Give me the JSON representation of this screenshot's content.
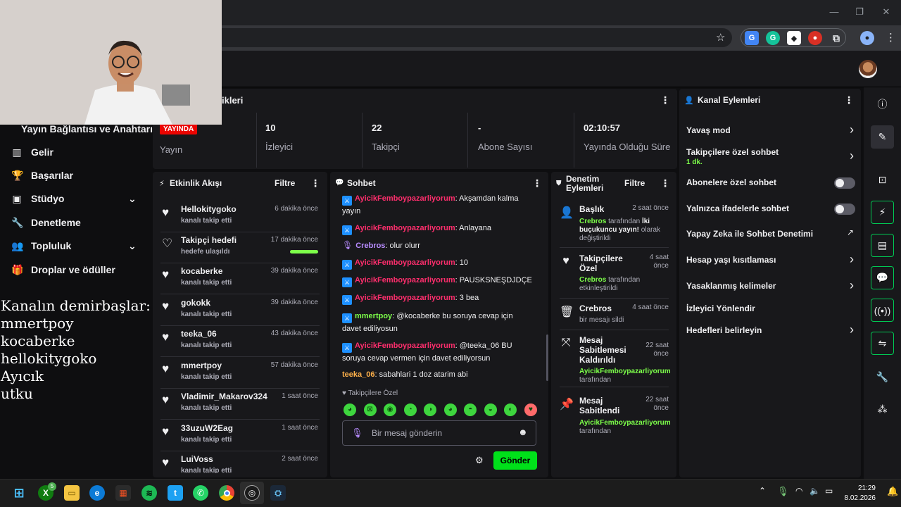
{
  "sidebar": {
    "stream_key_label": "Yayın Bağlantısı ve Anahtarı",
    "items": [
      {
        "label": "Gelir",
        "icon": "revenue-icon"
      },
      {
        "label": "Başarılar",
        "icon": "trophy-icon"
      },
      {
        "label": "Stüdyo",
        "icon": "studio-icon"
      },
      {
        "label": "Denetleme",
        "icon": "wrench-icon"
      },
      {
        "label": "Topluluk",
        "icon": "community-icon"
      },
      {
        "label": "Droplar ve ödüller",
        "icon": "gift-icon"
      }
    ]
  },
  "overlay_text": [
    "Kanalın demirbaşlar:",
    "mmertpoy",
    "kocaberke",
    "hellokitygoko",
    "Ayıcık",
    "utku"
  ],
  "stats": {
    "title_fragment": "ikleri",
    "live_badge": "YAYINDA",
    "live_label": "Yayın",
    "viewers_value": "10",
    "viewers_label": "İzleyici",
    "followers_value": "22",
    "followers_label": "Takipçi",
    "subs_value": "-",
    "subs_label": "Abone Sayısı",
    "uptime_value": "02:10:57",
    "uptime_label": "Yayında Olduğu Süre"
  },
  "activity": {
    "title": "Etkinlik Akışı",
    "filter": "Filtre",
    "items": [
      {
        "name": "Hellokitygoko",
        "sub": "kanalı takip etti",
        "time": "6 dakika önce"
      },
      {
        "name": "Takipçi hedefi",
        "sub": "hedefe ulaşıldı",
        "time": "17 dakika önce",
        "progress": 1.0
      },
      {
        "name": "kocaberke",
        "sub": "kanalı takip etti",
        "time": "39 dakika önce"
      },
      {
        "name": "gokokk",
        "sub": "kanalı takip etti",
        "time": "39 dakika önce"
      },
      {
        "name": "teeka_06",
        "sub": "kanalı takip etti",
        "time": "43 dakika önce"
      },
      {
        "name": "mmertpoy",
        "sub": "kanalı takip etti",
        "time": "57 dakika önce"
      },
      {
        "name": "Vladimir_Makarov324",
        "sub": "kanalı takip etti",
        "time": "1 saat önce"
      },
      {
        "name": "33uzuW2Eag",
        "sub": "kanalı takip etti",
        "time": "1 saat önce"
      },
      {
        "name": "LuiVoss",
        "sub": "kanalı takip etti",
        "time": "2 saat önce"
      }
    ]
  },
  "chat": {
    "title": "Sohbet",
    "messages": [
      {
        "user": "AyicikFemboypazarliyorum",
        "text": "Akşamdan kalma yayın"
      },
      {
        "user": "AyicikFemboypazarliyorum",
        "text": "Anlayana"
      },
      {
        "user": "Crebros",
        "text": "olur olurr"
      },
      {
        "user": "AyicikFemboypazarliyorum",
        "text": "10"
      },
      {
        "user": "AyicikFemboypazarliyorum",
        "text": "PAUSKSNEŞDJDÇE"
      },
      {
        "user": "AyicikFemboypazarliyorum",
        "text": "3 bea"
      },
      {
        "user": "mmertpoy",
        "text": "@kocaberke bu soruya cevap için davet ediliyosun"
      },
      {
        "user": "AyicikFemboypazarliyorum",
        "text": "@teeka_06 BU soruya cevap vermen için davet ediliyorsun"
      },
      {
        "user": "teeka_06",
        "text": "sabahlari 1 doz atarim abi"
      }
    ],
    "followers_only_label": "Takipçilere Özel",
    "input_placeholder": "Bir mesaj gönderin",
    "send_label": "Gönder"
  },
  "mod_actions": {
    "title_line1": "Denetim",
    "title_line2": "Eylemleri",
    "filter": "Filtre",
    "items": [
      {
        "title": "Başlık",
        "time": "2 saat önce",
        "actor": "Crebros",
        "rest1": "tarafından",
        "highlight": "İki buçukuncu yayın!",
        "rest2": "olarak değiştirildi"
      },
      {
        "title": "Takipçilere Özel",
        "time": "4 saat önce",
        "actor": "Crebros",
        "rest1": "tarafından etkinleştirildi"
      },
      {
        "title": "Crebros",
        "time": "4 saat önce",
        "rest1": "bir mesajı sildi"
      },
      {
        "title": "Mesaj Sabitlemesi Kaldırıldı",
        "time": "22 saat önce",
        "actor": "AyicikFemboypazarliyorum",
        "rest1": "tarafından"
      },
      {
        "title": "Mesaj Sabitlendi",
        "time": "22 saat önce",
        "actor": "AyicikFemboypazarliyorum",
        "rest1": "tarafından"
      }
    ]
  },
  "channel_actions": {
    "title": "Kanal Eylemleri",
    "items": [
      {
        "label": "Yavaş mod"
      },
      {
        "label": "Takipçilere özel sohbet",
        "sub": "1 dk."
      },
      {
        "label": "Abonelere özel sohbet",
        "toggle": false
      },
      {
        "label": "Yalnızca ifadelerle sohbet",
        "toggle": false
      },
      {
        "label": "Yapay Zeka ile Sohbet Denetimi"
      },
      {
        "label": "Hesap yaşı kısıtlaması"
      },
      {
        "label": "Yasaklanmış kelimeler"
      },
      {
        "label": "İzleyici Yönlendir"
      },
      {
        "label": "Hedefleri belirleyin"
      }
    ]
  },
  "taskbar": {
    "time": "21:29",
    "date": "8.02.2026",
    "xbox_badge": "5"
  },
  "colors": {
    "accent_green": "#7dff4a",
    "live_red": "#eb0400",
    "username_red": "#ff2e6d"
  }
}
